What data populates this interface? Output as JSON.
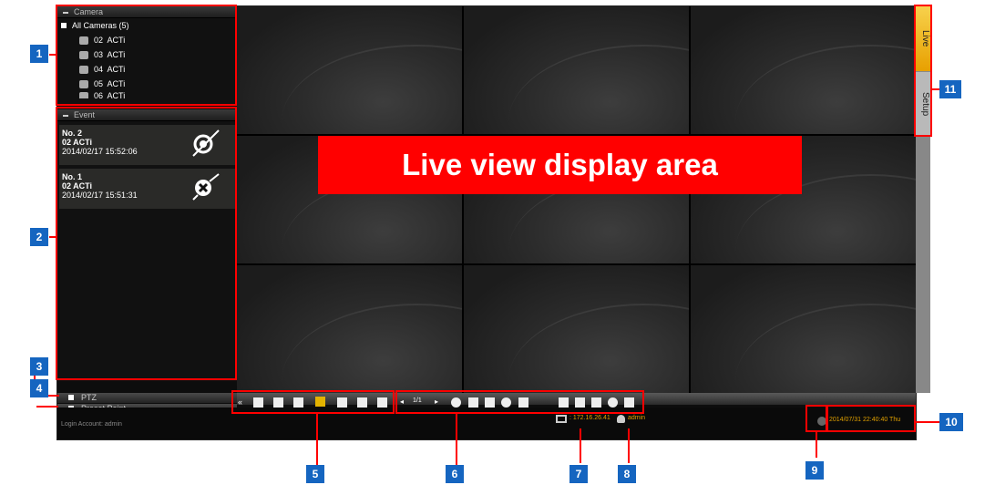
{
  "camera_panel": {
    "header": "Camera",
    "root": "All Cameras (5)",
    "cameras": [
      {
        "num": "02",
        "name": "ACTi"
      },
      {
        "num": "03",
        "name": "ACTi"
      },
      {
        "num": "04",
        "name": "ACTi"
      },
      {
        "num": "05",
        "name": "ACTi"
      },
      {
        "num": "06",
        "name": "ACTi"
      }
    ]
  },
  "event_panel": {
    "header": "Event",
    "events": [
      {
        "no": "No. 2",
        "camera": "02 ACTi",
        "time": "2014/02/17 15:52:06"
      },
      {
        "no": "No. 1",
        "camera": "02 ACTi",
        "time": "2014/02/17 15:51:31"
      }
    ]
  },
  "live_label": "Live view display area",
  "tabs": {
    "live": "Live",
    "setup": "Setup"
  },
  "ptz_label": "PTZ",
  "preset_label": "Preset Point",
  "login": "Login Account: admin",
  "page_indicator": "1/1",
  "server_ip": ": 172.16.26.41",
  "user": "admin",
  "datetime": "2014/07/31 22:40:40 Thu",
  "badges": [
    "1",
    "2",
    "3",
    "4",
    "5",
    "6",
    "7",
    "8",
    "9",
    "10",
    "11"
  ],
  "colors": {
    "highlight": "#ff0000",
    "badge": "#1565c0",
    "live_tab": "#f2b800",
    "datetime_text": "#e0a000"
  }
}
